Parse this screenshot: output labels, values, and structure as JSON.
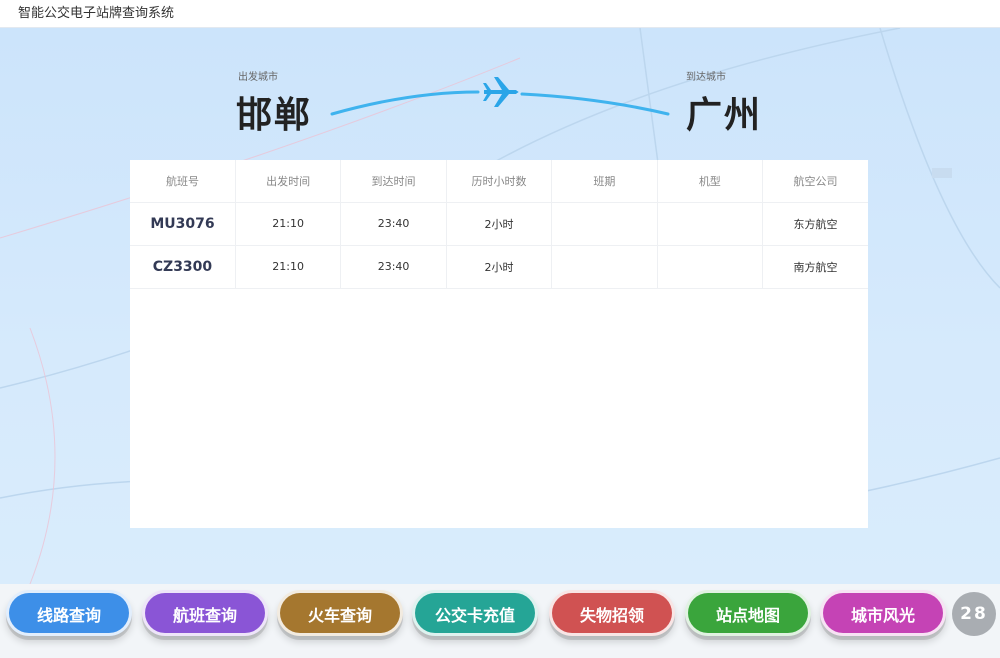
{
  "window": {
    "title": "智能公交电子站牌查询系统"
  },
  "route": {
    "from_label": "出发城市",
    "from_city": "邯郸",
    "to_label": "到达城市",
    "to_city": "广州",
    "icon": "airplane-icon"
  },
  "flights": {
    "columns": [
      "航班号",
      "出发时间",
      "到达时间",
      "历时小时数",
      "班期",
      "机型",
      "航空公司"
    ],
    "rows": [
      {
        "flight": "MU3076",
        "depart": "21:10",
        "arrive": "23:40",
        "duration": "2小时",
        "schedule": "",
        "aircraft": "",
        "airline": "东方航空"
      },
      {
        "flight": "CZ3300",
        "depart": "21:10",
        "arrive": "23:40",
        "duration": "2小时",
        "schedule": "",
        "aircraft": "",
        "airline": "南方航空"
      }
    ]
  },
  "nav": {
    "buttons": [
      {
        "label": "线路查询",
        "color": "#3d8fe8"
      },
      {
        "label": "航班查询",
        "color": "#8a55d6"
      },
      {
        "label": "火车查询",
        "color": "#a5772f"
      },
      {
        "label": "公交卡充值",
        "color": "#25a596"
      },
      {
        "label": "失物招领",
        "color": "#d05252"
      },
      {
        "label": "站点地图",
        "color": "#3aa53c"
      },
      {
        "label": "城市风光",
        "color": "#c543b5"
      }
    ],
    "counter": "28"
  }
}
